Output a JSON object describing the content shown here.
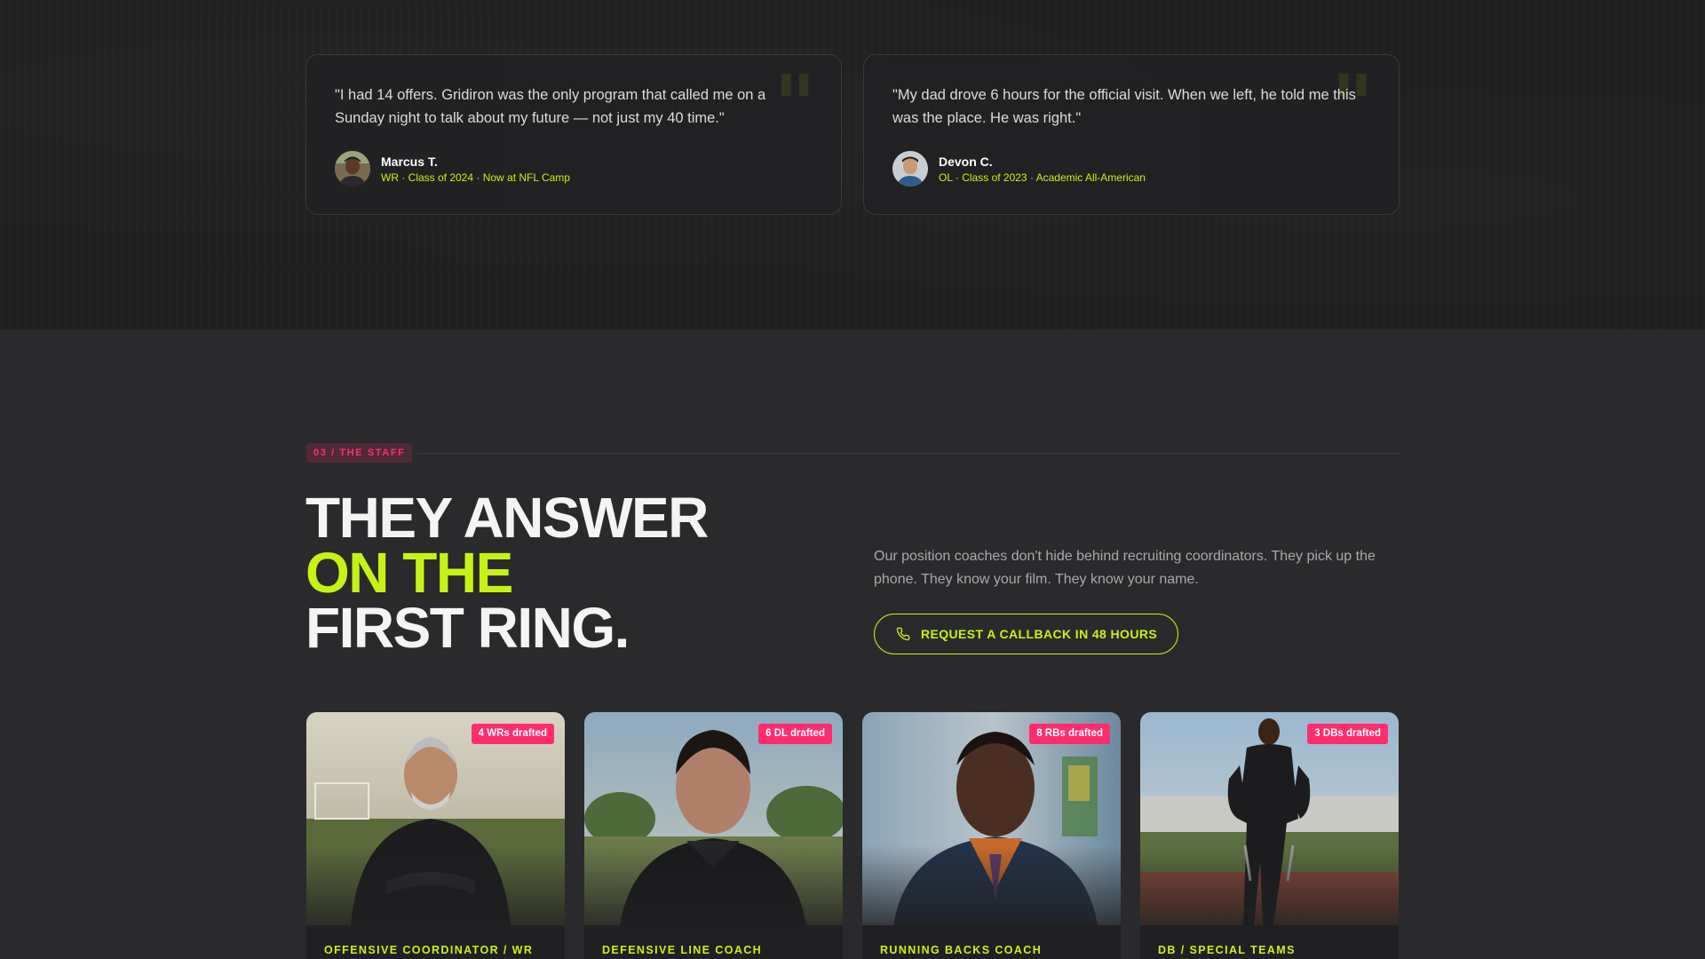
{
  "testimonials": [
    {
      "quote": "\"I had 14 offers. Gridiron was the only program that called me on a Sunday night to talk about my future — not just my 40 time.\"",
      "name": "Marcus T.",
      "meta": "WR · Class of 2024 · Now at NFL Camp"
    },
    {
      "quote": "\"My dad drove 6 hours for the official visit. When we left, he told me this was the place. He was right.\"",
      "name": "Devon C.",
      "meta": "OL · Class of 2023 · Academic All-American"
    }
  ],
  "staff": {
    "eyebrow": "03 / THE STAFF",
    "headline_line1": "THEY ANSWER",
    "headline_line2": "ON THE",
    "headline_line3": "FIRST RING.",
    "intro": "Our position coaches don't hide behind recruiting coordinators. They pick up the phone. They know your film. They know your name.",
    "cta_label": "REQUEST A CALLBACK IN 48 HOURS",
    "cta_icon": "phone-icon"
  },
  "coaches": [
    {
      "badge": "4 WRs drafted",
      "role": "OFFENSIVE COORDINATOR / WR"
    },
    {
      "badge": "6 DL drafted",
      "role": "DEFENSIVE LINE COACH"
    },
    {
      "badge": "8 RBs drafted",
      "role": "RUNNING BACKS COACH"
    },
    {
      "badge": "3 DBs drafted",
      "role": "DB / SPECIAL TEAMS"
    }
  ],
  "colors": {
    "accent": "#c6f216",
    "badge": "#ff2d6e",
    "background": "#2a2a2c",
    "band": "#1f1f20"
  }
}
